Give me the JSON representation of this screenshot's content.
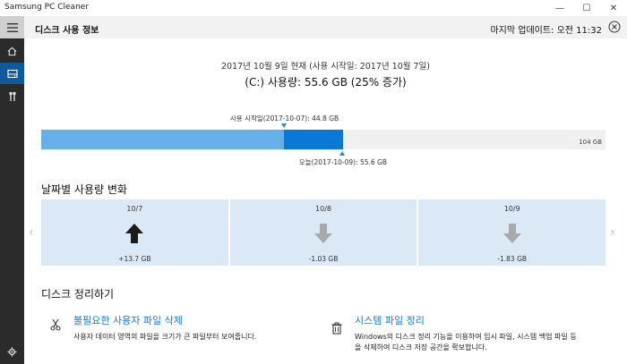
{
  "window": {
    "title": "Samsung PC Cleaner",
    "minimize": "—",
    "maximize": "☐",
    "close": "✕"
  },
  "rail": {
    "items": [
      {
        "icon": "hamburger-menu-icon"
      },
      {
        "icon": "home-icon"
      },
      {
        "icon": "disk-icon",
        "active": true
      },
      {
        "icon": "tools-icon"
      },
      {
        "icon": "gear-icon"
      }
    ]
  },
  "header": {
    "title": "디스크 사용 정보",
    "last_update": "마지막 업데이트: 오전 11:32"
  },
  "summary": {
    "date_line": "2017년 10월 9일 현재 (사용 시작일: 2017년 10월 7일)",
    "usage_line": "(C:) 사용량: 55.6 GB (25% 증가)"
  },
  "usage_bar": {
    "total_label": "104 GB",
    "start_label": "사용 시작일(2017-10-07): 44.8 GB",
    "today_label": "오늘(2017-10-09): 55.6 GB",
    "total_gb": 104,
    "start_gb": 44.8,
    "today_gb": 55.6,
    "colors": {
      "start": "#66b0ea",
      "increase": "#0a78d7",
      "free": "#f0f0f0"
    }
  },
  "daily": {
    "title": "날짜별 사용량 변화",
    "tiles": [
      {
        "date": "10/7",
        "value": "+13.7 GB",
        "direction": "up"
      },
      {
        "date": "10/8",
        "value": "-1.03 GB",
        "direction": "down"
      },
      {
        "date": "10/9",
        "value": "-1.83 GB",
        "direction": "down"
      }
    ],
    "prev": "‹",
    "next": "›"
  },
  "cleanup": {
    "title": "디스크 정리하기",
    "items": [
      {
        "icon": "scissors-icon",
        "title": "불필요한 사용자 파일 삭제",
        "desc_lines": [
          "사용자 데이터 영역의 파일을 크기가 큰 파일부터 보여줍니다."
        ]
      },
      {
        "icon": "trash-icon",
        "title": "시스템 파일 정리",
        "desc_lines": [
          "Windows의 디스크 정리 기능을 이용하여 임시 파일, 시스템 백업 파일 등",
          "을 삭제하여 디스크 저장 공간을 확보합니다."
        ]
      }
    ]
  },
  "accent_color": "#1a7ac9"
}
